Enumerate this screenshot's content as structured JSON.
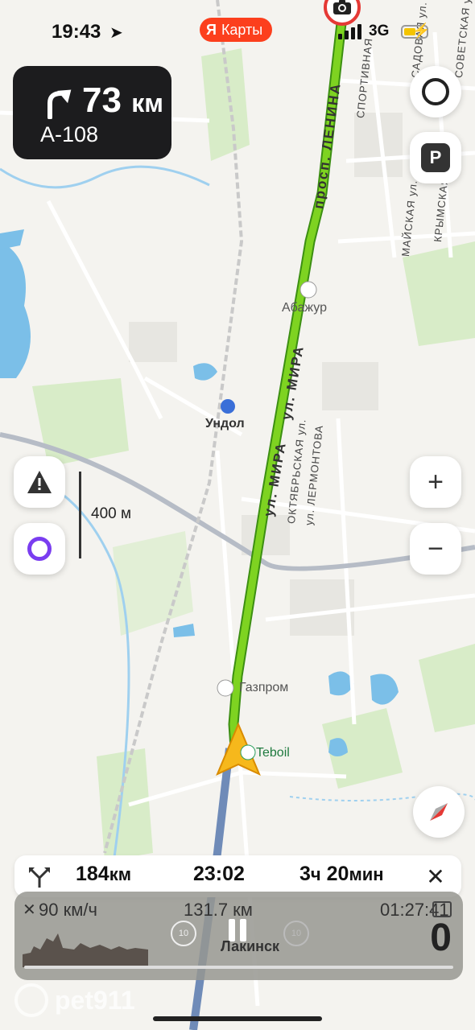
{
  "status_bar": {
    "time": "19:43",
    "network": "3G",
    "brand_letter": "Я",
    "brand_name": "Карты"
  },
  "maneuver": {
    "distance": "73",
    "unit": "км",
    "road": "А-108"
  },
  "map": {
    "scale_label": "400 м",
    "places": {
      "settlement": "Ундол",
      "hotel": "Абажур",
      "gas_station_1": "Газпром",
      "gas_station_2": "Teboil"
    },
    "streets": {
      "lenina": "просп. ЛЕНИНА",
      "mira_1": "ул. МИРА",
      "mira_2": "ул. МИРА",
      "oktyabrskaya": "ОКТЯБРЬСКАЯ ул.",
      "lermontova": "ул. ЛЕРМОНТОВА",
      "sportivnaya": "СПОРТИВНАЯ",
      "sadovaya": "САДОВАЯ ул.",
      "sovetskaya": "СОВЕТСКАЯ ул.",
      "mayskaya": "МАЙСКАЯ ул.",
      "krymskaya": "КРЫМСКАЯ"
    }
  },
  "route_summary": {
    "distance": "184",
    "distance_unit": "км",
    "arrival": "23:02",
    "duration_h": "3",
    "duration_h_unit": "ч",
    "duration_m": "20",
    "duration_m_unit": "мин"
  },
  "media_overlay": {
    "speed": "90 км/ч",
    "distance": "131.7 км",
    "time": "01:27:41",
    "big_number": "0",
    "track_label": "Лакинск",
    "skip_back": "10",
    "skip_forward": "10"
  },
  "watermark": "pet911",
  "colors": {
    "route": "#7ed321",
    "brand": "#fc3f1d",
    "water": "#7bbfe8",
    "park": "#d8ecc8"
  }
}
